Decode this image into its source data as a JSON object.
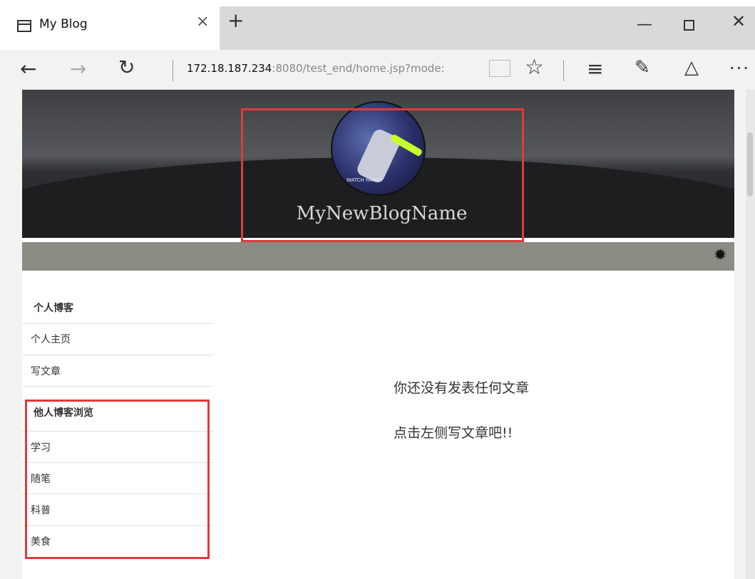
{
  "browser": {
    "tab_title": "My Blog",
    "tab_close": "×",
    "new_tab": "+",
    "url_host": "172.18.187.234",
    "url_rest": ":8080/test_end/home.jsp?mode:",
    "window_min": "—",
    "window_close": "✕"
  },
  "header": {
    "blog_name": "MyNewBlogName",
    "avatar_caption": "WATCH FAMILY"
  },
  "sidebar": {
    "personal": {
      "heading": "个人博客",
      "items": [
        {
          "label": "个人主页"
        },
        {
          "label": "写文章"
        }
      ]
    },
    "others": {
      "heading": "他人博客浏览",
      "items": [
        {
          "label": "学习"
        },
        {
          "label": "随笔"
        },
        {
          "label": "科普"
        },
        {
          "label": "美食"
        }
      ]
    }
  },
  "main": {
    "empty_line1": "你还没有发表任何文章",
    "empty_line2": "点击左侧写文章吧!!"
  },
  "colors": {
    "highlight": "#e03a3a",
    "toolbar": "#8c8b84"
  }
}
